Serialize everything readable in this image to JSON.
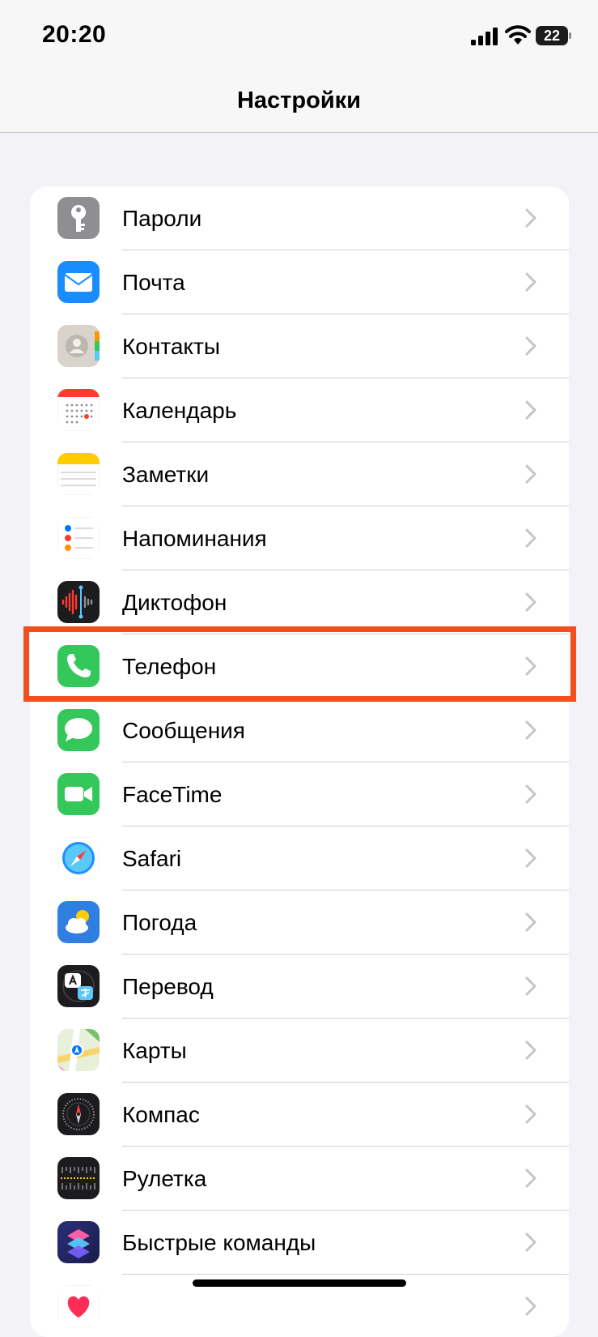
{
  "status": {
    "time": "20:20",
    "battery": "22"
  },
  "nav": {
    "title": "Настройки"
  },
  "items": [
    {
      "id": "passwords",
      "label": "Пароли",
      "icon": "key-icon"
    },
    {
      "id": "mail",
      "label": "Почта",
      "icon": "mail-icon"
    },
    {
      "id": "contacts",
      "label": "Контакты",
      "icon": "contacts-icon"
    },
    {
      "id": "calendar",
      "label": "Календарь",
      "icon": "calendar-icon"
    },
    {
      "id": "notes",
      "label": "Заметки",
      "icon": "notes-icon"
    },
    {
      "id": "reminders",
      "label": "Напоминания",
      "icon": "reminders-icon"
    },
    {
      "id": "voice-memos",
      "label": "Диктофон",
      "icon": "voice-memo-icon"
    },
    {
      "id": "phone",
      "label": "Телефон",
      "icon": "phone-icon",
      "highlighted": true
    },
    {
      "id": "messages",
      "label": "Сообщения",
      "icon": "messages-icon"
    },
    {
      "id": "facetime",
      "label": "FaceTime",
      "icon": "facetime-icon"
    },
    {
      "id": "safari",
      "label": "Safari",
      "icon": "safari-icon"
    },
    {
      "id": "weather",
      "label": "Погода",
      "icon": "weather-icon"
    },
    {
      "id": "translate",
      "label": "Перевод",
      "icon": "translate-icon"
    },
    {
      "id": "maps",
      "label": "Карты",
      "icon": "maps-icon"
    },
    {
      "id": "compass",
      "label": "Компас",
      "icon": "compass-icon"
    },
    {
      "id": "measure",
      "label": "Рулетка",
      "icon": "measure-icon"
    },
    {
      "id": "shortcuts",
      "label": "Быстрые команды",
      "icon": "shortcuts-icon"
    },
    {
      "id": "health",
      "label": "",
      "icon": "health-icon"
    }
  ],
  "colors": {
    "highlight": "#f24e1e",
    "background": "#f2f2f7"
  }
}
